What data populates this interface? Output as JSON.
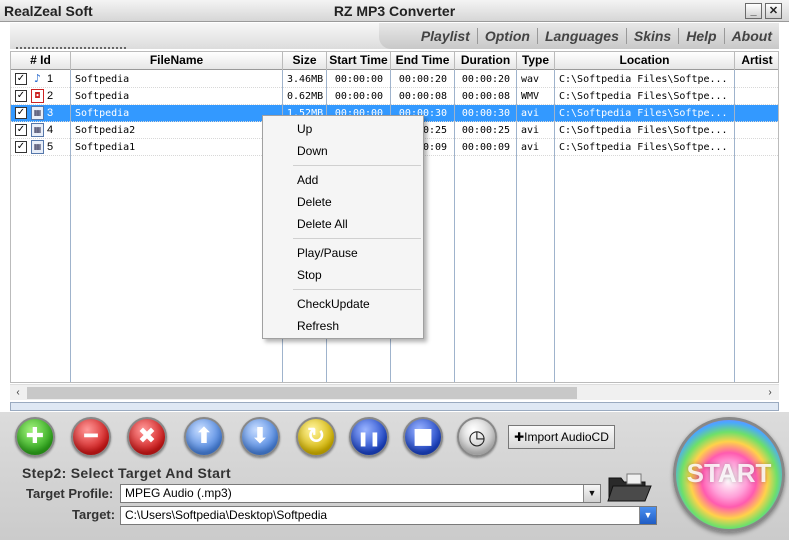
{
  "window": {
    "brand": "RealZeal Soft",
    "title": "RZ MP3 Converter",
    "minimize_glyph": "_",
    "maximize_glyph": "□",
    "close_glyph": "✕"
  },
  "menu": {
    "items": [
      "Playlist",
      "Option",
      "Languages",
      "Skins",
      "Help",
      "About"
    ]
  },
  "grid": {
    "columns": [
      "# Id",
      "FileName",
      "Size",
      "Start Time",
      "End Time",
      "Duration",
      "Type",
      "Location",
      "Artist"
    ],
    "rows": [
      {
        "id": "1",
        "file": "Softpedia",
        "size": "3.46MB",
        "start": "00:00:00",
        "end": "00:00:20",
        "duration": "00:00:20",
        "type": "wav",
        "location": "C:\\Softpedia Files\\Softpe...",
        "checked": "✓",
        "icon": "♪",
        "icon_name": "music-note-icon"
      },
      {
        "id": "2",
        "file": "Softpedia",
        "size": "0.62MB",
        "start": "00:00:00",
        "end": "00:00:08",
        "duration": "00:00:08",
        "type": "WMV",
        "location": "C:\\Softpedia Files\\Softpe...",
        "checked": "✓",
        "icon": "◘",
        "icon_name": "video-icon"
      },
      {
        "id": "3",
        "file": "Softpedia",
        "size": "1.52MB",
        "start": "00:00:00",
        "end": "00:00:30",
        "duration": "00:00:30",
        "type": "avi",
        "location": "C:\\Softpedia Files\\Softpe...",
        "checked": "✓",
        "icon": "▦",
        "icon_name": "film-icon"
      },
      {
        "id": "4",
        "file": "Softpedia2",
        "size": "",
        "start": "",
        "end": "00:00:25",
        "duration": "00:00:25",
        "type": "avi",
        "location": "C:\\Softpedia Files\\Softpe...",
        "checked": "✓",
        "icon": "▦",
        "icon_name": "film-icon"
      },
      {
        "id": "5",
        "file": "Softpedia1",
        "size": "",
        "start": "",
        "end": "00:00:09",
        "duration": "00:00:09",
        "type": "avi",
        "location": "C:\\Softpedia Files\\Softpe...",
        "checked": "✓",
        "icon": "▦",
        "icon_name": "film-icon"
      }
    ],
    "selected_row": 2
  },
  "context_menu": {
    "groups": [
      [
        "Up",
        "Down"
      ],
      [
        "Add",
        "Delete",
        "Delete All"
      ],
      [
        "Play/Pause",
        "Stop"
      ],
      [
        "CheckUpdate",
        "Refresh"
      ]
    ]
  },
  "scroll": {
    "left_arrow": "‹",
    "right_arrow": "›"
  },
  "progress": {
    "fraction": 0.0
  },
  "toolbar": {
    "buttons": [
      {
        "name": "add-button",
        "glyph": "✚",
        "color": "green"
      },
      {
        "name": "remove-button",
        "glyph": "━",
        "color": "red"
      },
      {
        "name": "delete-all-button",
        "glyph": "✖",
        "color": "red"
      },
      {
        "name": "move-up-button",
        "glyph": "⬆",
        "color": "blue"
      },
      {
        "name": "move-down-button",
        "glyph": "⬇",
        "color": "blue"
      },
      {
        "name": "refresh-button",
        "glyph": "↻",
        "color": "yellow"
      },
      {
        "name": "pause-button",
        "glyph": "❚❚",
        "color": "navy"
      },
      {
        "name": "stop-button",
        "glyph": "■",
        "color": "navy"
      },
      {
        "name": "timer-button",
        "glyph": "◷",
        "color": "clock"
      }
    ],
    "import_label": "Import AudioCD",
    "import_glyph": "✚"
  },
  "step2": {
    "title": "Step2: Select Target And Start",
    "profile_label": "Target Profile:",
    "profile_value": "MPEG Audio (.mp3)",
    "target_label": "Target:",
    "target_value": "C:\\Users\\Softpedia\\Desktop\\Softpedia",
    "dropdown_glyph": "▼"
  },
  "start": {
    "label": "START"
  },
  "colors": {
    "selection": "#3399ff",
    "grid_lines": "#9fb3cc"
  }
}
